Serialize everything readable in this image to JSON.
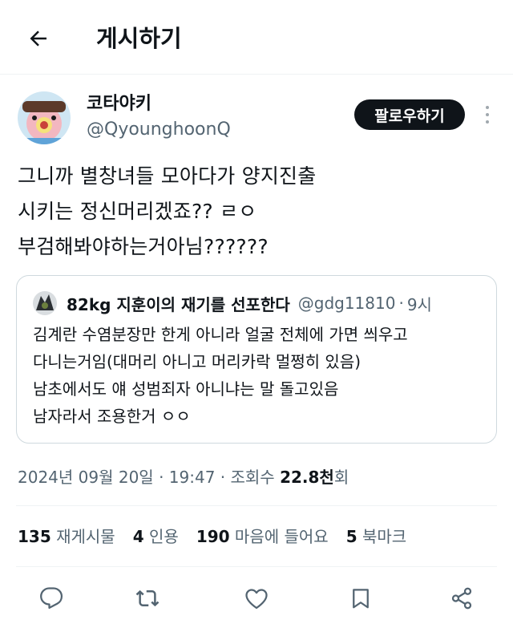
{
  "header": {
    "title": "게시하기"
  },
  "author": {
    "name": "코타야키",
    "handle": "@QyounghoonQ",
    "follow_label": "팔로우하기"
  },
  "tweet": {
    "lines": [
      "그니까 별창녀들 모아다가 양지진출",
      "시키는 정신머리겠죠?? ㄹㅇ",
      "부검해봐야하는거아님??????"
    ]
  },
  "quote": {
    "name": "82kg 지훈이의 재기를 선포한다",
    "handle": "@gdg11810",
    "separator": "·",
    "time": "9시",
    "lines": [
      "김계란 수염분장만 한게 아니라 얼굴 전체에 가면 씌우고",
      "다니는거임(대머리 아니고 머리카락 멀쩡히 있음)",
      "남초에서도 얘 성범죄자 아니냐는 말 돌고있음",
      "남자라서 조용한거 ㅇㅇ"
    ]
  },
  "meta": {
    "date_time": "2024년 09월 20일 · 19:47 · 조회수 ",
    "views_num": "22.8천",
    "views_suffix": "회"
  },
  "stats": [
    {
      "num": "135",
      "label": "재게시물"
    },
    {
      "num": "4",
      "label": "인용"
    },
    {
      "num": "190",
      "label": "마음에 들어요"
    },
    {
      "num": "5",
      "label": "북마크"
    }
  ],
  "colors": {
    "text": "#0f1419",
    "secondary": "#536471",
    "border": "#cfd9de",
    "follow_bg": "#0f1419"
  },
  "icons": [
    "back-arrow-icon",
    "more-vertical-icon",
    "reply-icon",
    "retweet-icon",
    "like-icon",
    "bookmark-icon",
    "share-icon"
  ]
}
